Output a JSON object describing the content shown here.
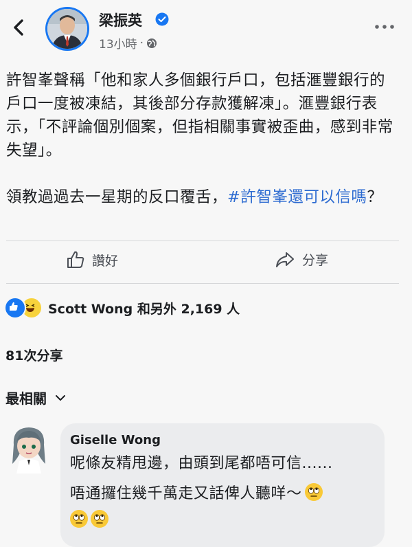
{
  "header": {
    "author_name": "梁振英",
    "timestamp": "13小時",
    "separator": "·",
    "audience_icon": "globe-icon"
  },
  "post": {
    "paragraph_1": "許智峯聲稱「他和家人多個銀行戶口，包括滙豐銀行的戶口一度被凍結，其後部分存款獲解凍」。滙豐銀行表示，「不評論個別個案，但指相關事實被歪曲，感到非常失望」。",
    "paragraph_2_prefix": "領教過過去一星期的反口覆舌，",
    "hashtag": "#許智峯還可以信嗎",
    "paragraph_2_suffix": "？"
  },
  "actions": {
    "like_label": "讚好",
    "share_label": "分享"
  },
  "reactions": {
    "text": "Scott Wong 和另外 2,169 人",
    "icons": [
      "like-icon",
      "haha-icon"
    ]
  },
  "shares": {
    "text": "81次分享"
  },
  "comments_filter": {
    "label": "最相關"
  },
  "comment": {
    "author": "Giselle Wong",
    "line_1": "呢條友精甩邊，由頭到尾都唔可信......",
    "line_2": "唔通攞住幾千萬走又話俾人聽咩～",
    "emojis": [
      "eye-roll-emoji",
      "eye-roll-emoji",
      "eye-roll-emoji"
    ]
  },
  "colors": {
    "accent": "#1877f2",
    "hashtag": "#2d6bd1",
    "secondary_text": "#65676b",
    "bubble": "#ebecee"
  }
}
